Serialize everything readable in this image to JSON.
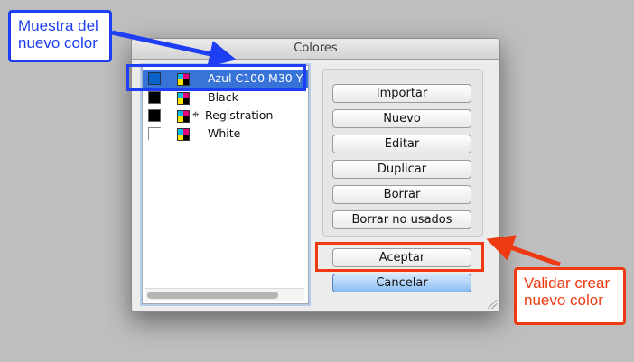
{
  "window": {
    "title": "Colores"
  },
  "swatches": [
    {
      "label": "Azul C100 M30 Y",
      "swatch_color": "#0a63c8",
      "selected": true,
      "registration": false
    },
    {
      "label": "Black",
      "swatch_color": "#000000",
      "selected": false,
      "registration": false
    },
    {
      "label": "Registration",
      "swatch_color": "#000000",
      "selected": false,
      "registration": true
    },
    {
      "label": "White",
      "swatch_color": "#ffffff",
      "selected": false,
      "registration": false
    }
  ],
  "buttons": {
    "importar": "Importar",
    "nuevo": "Nuevo",
    "editar": "Editar",
    "duplicar": "Duplicar",
    "borrar": "Borrar",
    "borrar_no_usados": "Borrar no usados",
    "aceptar": "Aceptar",
    "cancelar": "Cancelar"
  },
  "annotations": {
    "sample_callout": "Muestra del nuevo color",
    "validate_callout": "Validar crear nuevo color",
    "blue": "#1d3ef2",
    "red": "#ee3a12"
  },
  "icons": {
    "registration": "⌖",
    "cmyk": "cmyk-icon"
  }
}
